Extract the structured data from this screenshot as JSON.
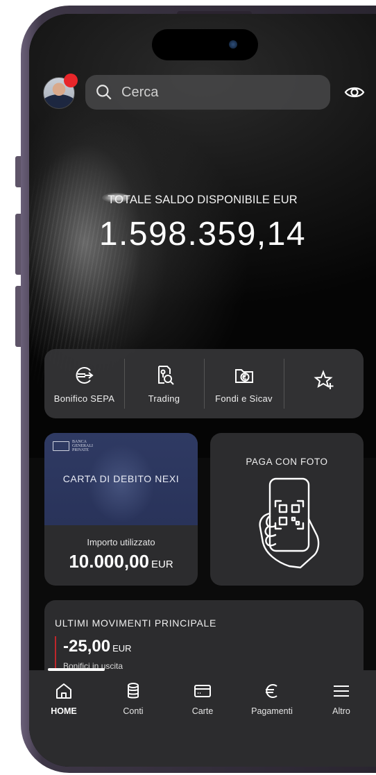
{
  "header": {
    "search_placeholder": "Cerca"
  },
  "balance": {
    "label": "TOTALE SALDO DISPONIBILE EUR",
    "value": "1.598.359,14"
  },
  "quick_actions": [
    {
      "label": "Bonifico SEPA",
      "icon": "euro-transfer-icon"
    },
    {
      "label": "Trading",
      "icon": "trading-search-icon"
    },
    {
      "label": "Fondi e Sicav",
      "icon": "euro-folder-icon"
    },
    {
      "label": "",
      "icon": "add-favorite-star-icon"
    }
  ],
  "card": {
    "bank_logo_lines": [
      "BANCA",
      "GENERALI",
      "PRIVATE"
    ],
    "name": "CARTA DI DEBITO NEXI",
    "used_label": "Importo utilizzato",
    "used_amount": "10.000,00",
    "used_currency": "EUR"
  },
  "photo_pay": {
    "title": "PAGA CON FOTO",
    "icon": "phone-qr-hand-icon"
  },
  "movements": {
    "title": "ULTIMI MOVIMENTI PRINCIPALE",
    "amount": "-25,00",
    "currency": "EUR",
    "description": "Bonifici in uscita"
  },
  "nav": {
    "items": [
      {
        "label": "HOME",
        "icon": "home-icon",
        "active": true
      },
      {
        "label": "Conti",
        "icon": "coins-stack-icon",
        "active": false
      },
      {
        "label": "Carte",
        "icon": "card-icon",
        "active": false
      },
      {
        "label": "Pagamenti",
        "icon": "euro-icon",
        "active": false
      },
      {
        "label": "Altro",
        "icon": "menu-icon",
        "active": false
      }
    ]
  },
  "colors": {
    "background": "#0b0b0b",
    "surface": "#2c2c2e",
    "card_blue": "#2f3a63",
    "notification": "#e8262a",
    "negative_marker": "#c0262b"
  }
}
